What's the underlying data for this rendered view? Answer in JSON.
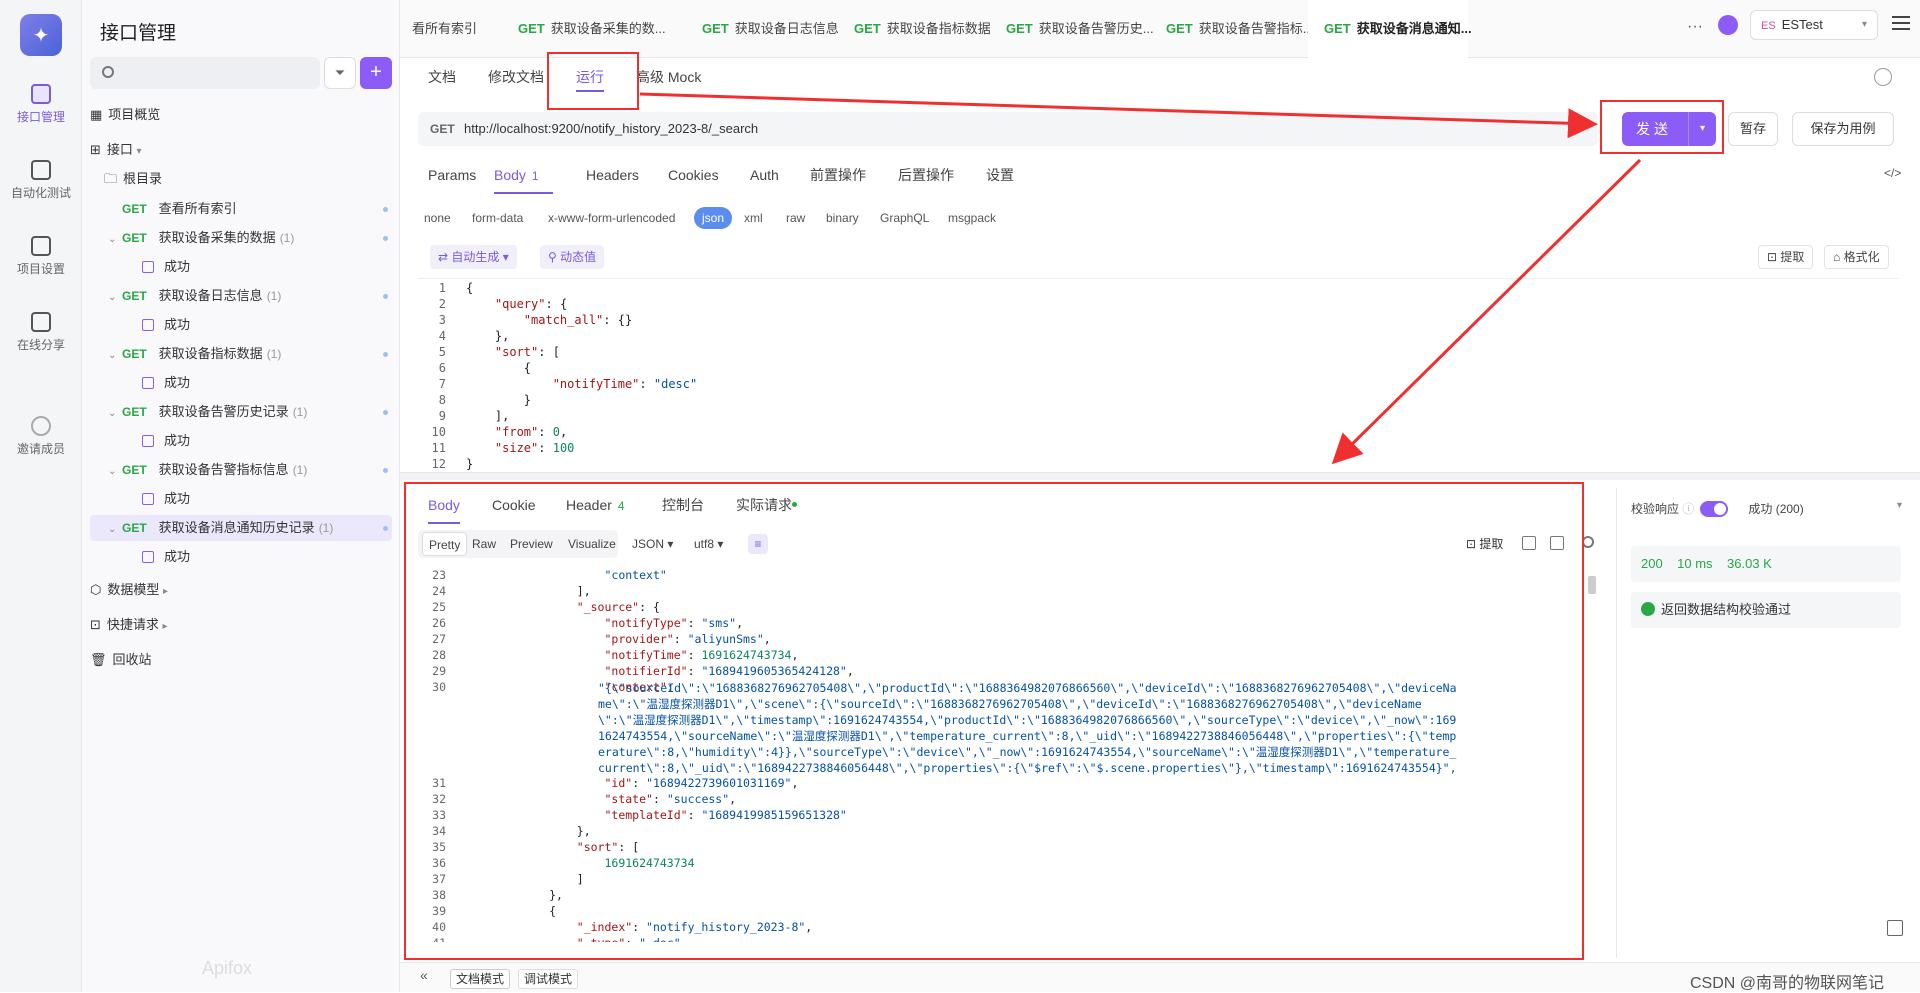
{
  "rail": {
    "items": [
      {
        "label": "接口管理",
        "active": true
      },
      {
        "label": "自动化测试"
      },
      {
        "label": "项目设置"
      },
      {
        "label": "在线分享"
      },
      {
        "label": "邀请成员"
      }
    ]
  },
  "sidebar": {
    "title": "接口管理",
    "overview": "项目概览",
    "api": "接口",
    "root": "根目录",
    "items": [
      {
        "method": "GET",
        "name": "查看所有索引",
        "count": ""
      },
      {
        "method": "GET",
        "name": "获取设备采集的数据",
        "count": "(1)",
        "child": "成功"
      },
      {
        "method": "GET",
        "name": "获取设备日志信息",
        "count": "(1)",
        "child": "成功"
      },
      {
        "method": "GET",
        "name": "获取设备指标数据",
        "count": "(1)",
        "child": "成功"
      },
      {
        "method": "GET",
        "name": "获取设备告警历史记录",
        "count": "(1)",
        "child": "成功"
      },
      {
        "method": "GET",
        "name": "获取设备告警指标信息",
        "count": "(1)",
        "child": "成功"
      },
      {
        "method": "GET",
        "name": "获取设备消息通知历史记录",
        "count": "(1)",
        "child": "成功"
      }
    ],
    "data_model": "数据模型",
    "quick_request": "快捷请求",
    "recycle": "回收站",
    "watermark": "Apifox"
  },
  "tabs": [
    {
      "method": "",
      "label": "看所有索引"
    },
    {
      "method": "GET",
      "label": "获取设备采集的数..."
    },
    {
      "method": "GET",
      "label": "获取设备日志信息"
    },
    {
      "method": "GET",
      "label": "获取设备指标数据"
    },
    {
      "method": "GET",
      "label": "获取设备告警历史..."
    },
    {
      "method": "GET",
      "label": "获取设备告警指标..."
    },
    {
      "method": "GET",
      "label": "获取设备消息通知..."
    }
  ],
  "topbar": {
    "more": "···",
    "env_badge": "ES",
    "env": "ESTest"
  },
  "subtabs": [
    "文档",
    "修改文档",
    "运行",
    "高级 Mock"
  ],
  "request": {
    "method": "GET",
    "url": "http://localhost:9200/notify_history_2023-8/_search",
    "send": "发送",
    "save": "暂存",
    "save_case": "保存为用例"
  },
  "param_tabs": [
    {
      "label": "Params"
    },
    {
      "label": "Body",
      "n": "1"
    },
    {
      "label": "Headers"
    },
    {
      "label": "Cookies"
    },
    {
      "label": "Auth"
    },
    {
      "label": "前置操作"
    },
    {
      "label": "后置操作"
    },
    {
      "label": "设置"
    }
  ],
  "body_types": [
    "none",
    "form-data",
    "x-www-form-urlencoded",
    "json",
    "xml",
    "raw",
    "binary",
    "GraphQL",
    "msgpack"
  ],
  "body_tools": {
    "auto": "自动生成",
    "dynamic": "动态值",
    "extract": "提取",
    "format": "格式化"
  },
  "request_body": [
    {
      "n": "1",
      "t": "{"
    },
    {
      "n": "2",
      "t": "    \"query\": {"
    },
    {
      "n": "3",
      "t": "        \"match_all\": {}"
    },
    {
      "n": "4",
      "t": "    },"
    },
    {
      "n": "5",
      "t": "    \"sort\": ["
    },
    {
      "n": "6",
      "t": "        {"
    },
    {
      "n": "7",
      "t": "            \"notifyTime\": \"desc\""
    },
    {
      "n": "8",
      "t": "        }"
    },
    {
      "n": "9",
      "t": "    ],"
    },
    {
      "n": "10",
      "t": "    \"from\": 0,"
    },
    {
      "n": "11",
      "t": "    \"size\": 100"
    },
    {
      "n": "12",
      "t": "}"
    }
  ],
  "resp_tabs": [
    {
      "label": "Body"
    },
    {
      "label": "Cookie"
    },
    {
      "label": "Header",
      "n": "4"
    },
    {
      "label": "控制台"
    },
    {
      "label": "实际请求"
    }
  ],
  "resp_format": {
    "modes": [
      "Pretty",
      "Raw",
      "Preview",
      "Visualize"
    ],
    "lang": "JSON",
    "enc": "utf8",
    "extract": "提取"
  },
  "response_body": [
    {
      "n": "23",
      "t": "                    \"context\""
    },
    {
      "n": "24",
      "t": "                ],"
    },
    {
      "n": "25",
      "t": "                \"_source\": {"
    },
    {
      "n": "26",
      "t": "                    \"notifyType\": \"sms\","
    },
    {
      "n": "27",
      "t": "                    \"provider\": \"aliyunSms\","
    },
    {
      "n": "28",
      "t": "                    \"notifyTime\": 1691624743734,"
    },
    {
      "n": "29",
      "t": "                    \"notifierId\": \"1689419605365424128\","
    },
    {
      "n": "30",
      "t": "                    \"context\": \"{\\\"sourceId\\\":\\\"1688368276962705408\\\",\\\"productId\\\":\\\"1688364982076866560\\\",\\\"deviceId\\\":\\\"1688368276962705408\\\",\\\"deviceName\\\":\\\"温湿度探测器D1\\\",\\\"scene\\\":{\\\"sourceId\\\":\\\"1688368276962705408\\\",\\\"deviceId\\\":\\\"1688368276962705408\\\",\\\"deviceName\\\":\\\"温湿度探测器D1\\\",\\\"timestamp\\\":1691624743554,\\\"productId\\\":\\\"1688364982076866560\\\",\\\"sourceType\\\":\\\"device\\\",\\\"_now\\\":1691624743554,\\\"sourceName\\\":\\\"温湿度探测器D1\\\",\\\"temperature_current\\\":8,\\\"_uid\\\":\\\"1689422738846056448\\\",\\\"properties\\\":{\\\"temperature\\\":8,\\\"humidity\\\":4}},\\\"sourceType\\\":\\\"device\\\",\\\"_now\\\":1691624743554,\\\"sourceName\\\":\\\"温湿度探测器D1\\\",\\\"temperature_current\\\":8,\\\"_uid\\\":\\\"1689422738846056448\\\",\\\"properties\\\":{\\\"$ref\\\":\\\"$.scene.properties\\\"},\\\"timestamp\\\":1691624743554}\","
    },
    {
      "n": "31",
      "t": "                    \"id\": \"1689422739601031169\","
    },
    {
      "n": "32",
      "t": "                    \"state\": \"success\","
    },
    {
      "n": "33",
      "t": "                    \"templateId\": \"1689419985159651328\""
    },
    {
      "n": "34",
      "t": "                },"
    },
    {
      "n": "35",
      "t": "                \"sort\": ["
    },
    {
      "n": "36",
      "t": "                    1691624743734"
    },
    {
      "n": "37",
      "t": "                ]"
    },
    {
      "n": "38",
      "t": "            },"
    },
    {
      "n": "39",
      "t": "            {"
    },
    {
      "n": "40",
      "t": "                \"_index\": \"notify_history_2023-8\","
    },
    {
      "n": "41",
      "t": "                \"_type\": \"_doc\","
    }
  ],
  "validate": {
    "label": "校验响应",
    "result": "成功 (200)",
    "status": "200",
    "time": "10 ms",
    "size": "36.03 K",
    "passed": "返回数据结构校验通过"
  },
  "bottombar": {
    "doc_mode": "文档模式",
    "debug_mode": "调试模式",
    "watermark": "CSDN @南哥的物联网笔记"
  },
  "colors": {
    "accent": "#8b5cf6",
    "get": "#29a745",
    "annotation": "#f03030"
  }
}
